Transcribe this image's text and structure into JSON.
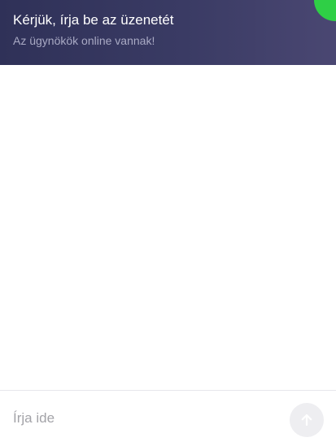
{
  "header": {
    "title": "Kérjük, írja be az üzenetét",
    "subtitle": "Az ügynökök online vannak!",
    "status_color": "#2fcf46"
  },
  "composer": {
    "placeholder": "Írja ide",
    "value": "",
    "send_icon": "arrow-up-icon"
  },
  "colors": {
    "header_background": "#383a62",
    "send_button_background": "#eeeef1",
    "send_icon": "#ffffff"
  }
}
